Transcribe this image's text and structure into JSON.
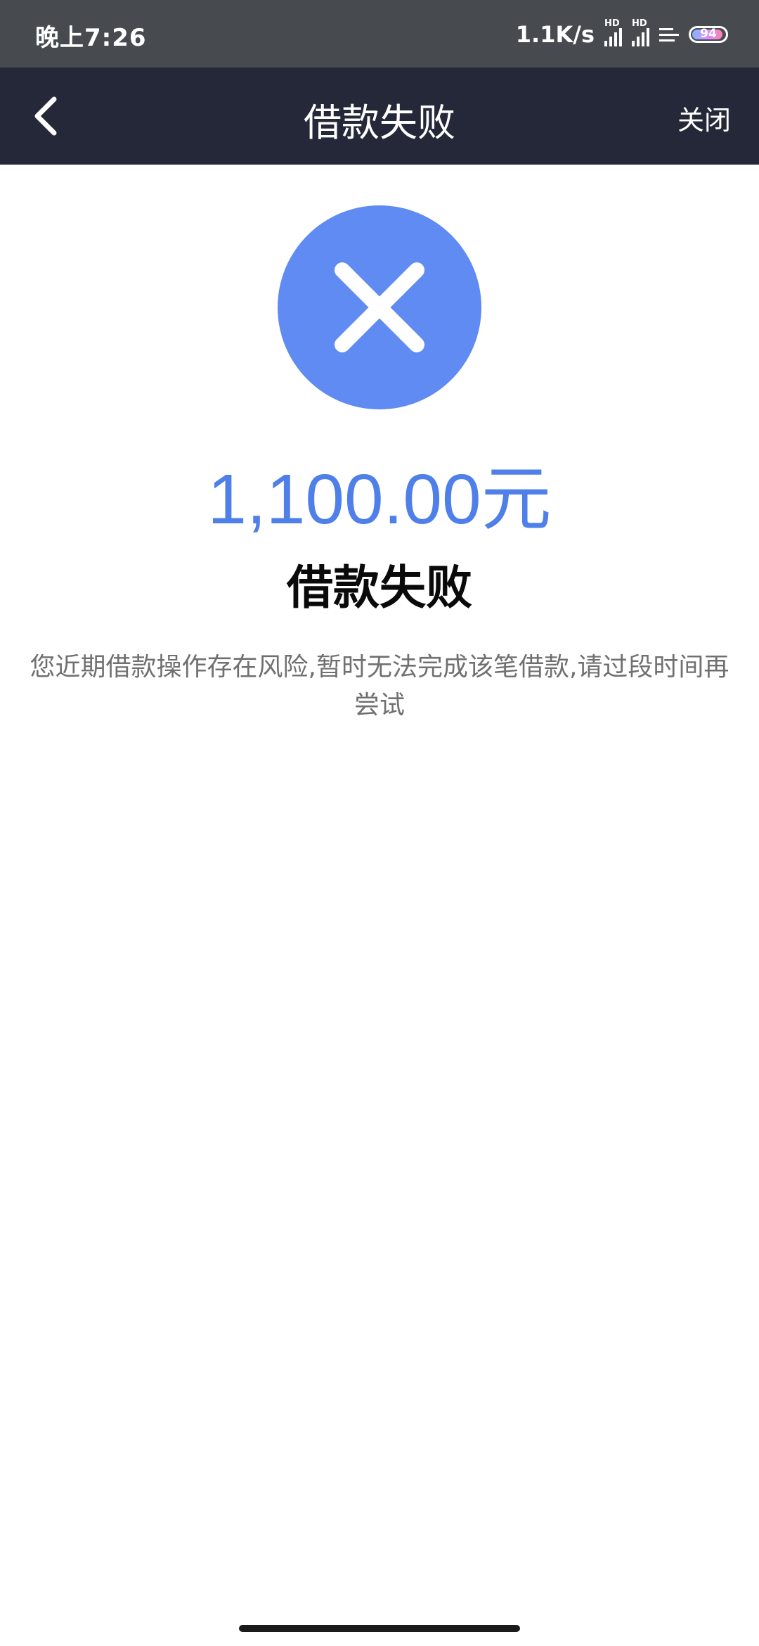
{
  "status_bar": {
    "time": "晚上7:26",
    "net_speed": "1.1K/s",
    "signal_label": "HD",
    "battery_level": "94"
  },
  "nav": {
    "title": "借款失败",
    "close_label": "关闭",
    "back_icon": "chevron-left-icon"
  },
  "result": {
    "icon": "close-x-icon",
    "icon_color": "#5f8bf2",
    "amount": "1,100.00元",
    "amount_color": "#4f7fe9",
    "title": "借款失败",
    "description": "您近期借款操作存在风险,暂时无法完成该笔借款,请过段时间再尝试"
  }
}
